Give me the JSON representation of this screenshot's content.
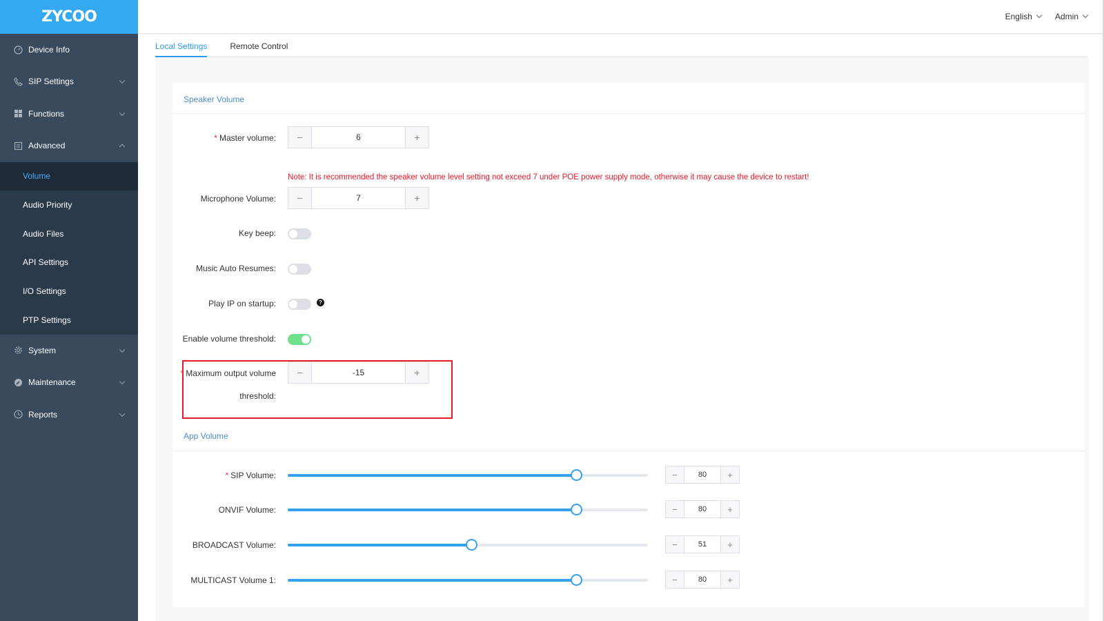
{
  "brand": {
    "logo_text": "ZYCOO"
  },
  "sidebar": {
    "items": [
      {
        "label": "Device Info",
        "icon": "gauge-icon",
        "has_chevron": false
      },
      {
        "label": "SIP Settings",
        "icon": "phone-icon",
        "has_chevron": true
      },
      {
        "label": "Functions",
        "icon": "grid-icon",
        "has_chevron": true
      },
      {
        "label": "Advanced",
        "icon": "document-icon",
        "has_chevron": true,
        "expanded": true
      }
    ],
    "advanced_sub": [
      {
        "label": "Volume",
        "active": true
      },
      {
        "label": "Audio Priority"
      },
      {
        "label": "Audio Files"
      },
      {
        "label": "API Settings"
      },
      {
        "label": "I/O Settings"
      },
      {
        "label": "PTP Settings"
      }
    ],
    "bottom_items": [
      {
        "label": "System",
        "icon": "gear-icon"
      },
      {
        "label": "Maintenance",
        "icon": "wrench-icon"
      },
      {
        "label": "Reports",
        "icon": "clock-icon"
      }
    ]
  },
  "header": {
    "language": "English",
    "user": "Admin"
  },
  "tabs": [
    {
      "label": "Local Settings",
      "active": true
    },
    {
      "label": "Remote Control"
    }
  ],
  "speaker": {
    "title": "Speaker Volume",
    "master_label": "Master volume:",
    "master_value": "6",
    "note": "Note: It is recommended the speaker volume level setting not exceed 7 under POE power supply mode, otherwise it may cause the device to restart!",
    "mic_label": "Microphone Volume:",
    "mic_value": "7",
    "key_beep_label": "Key beep:",
    "key_beep_on": false,
    "music_label": "Music Auto Resumes:",
    "music_on": false,
    "play_ip_label": "Play IP on startup:",
    "play_ip_on": false,
    "threshold_enable_label": "Enable volume threshold:",
    "threshold_enable_on": true,
    "max_output_label_1": "Maximum output volume",
    "max_output_label_2": "threshold:",
    "max_output_value": "-15"
  },
  "app": {
    "title": "App Volume",
    "rows": [
      {
        "label": "SIP Volume:",
        "value": "80",
        "required": true
      },
      {
        "label": "ONVIF Volume:",
        "value": "80",
        "required": false
      },
      {
        "label": "BROADCAST Volume:",
        "value": "51",
        "required": false
      },
      {
        "label": "MULTICAST Volume 1:",
        "value": "80",
        "required": false
      }
    ],
    "slider_max": 100
  },
  "colors": {
    "accent": "#2d9bf0",
    "sidebar": "#394a5e",
    "warning": "#e8182a",
    "toggle_on": "#6ee08e"
  }
}
